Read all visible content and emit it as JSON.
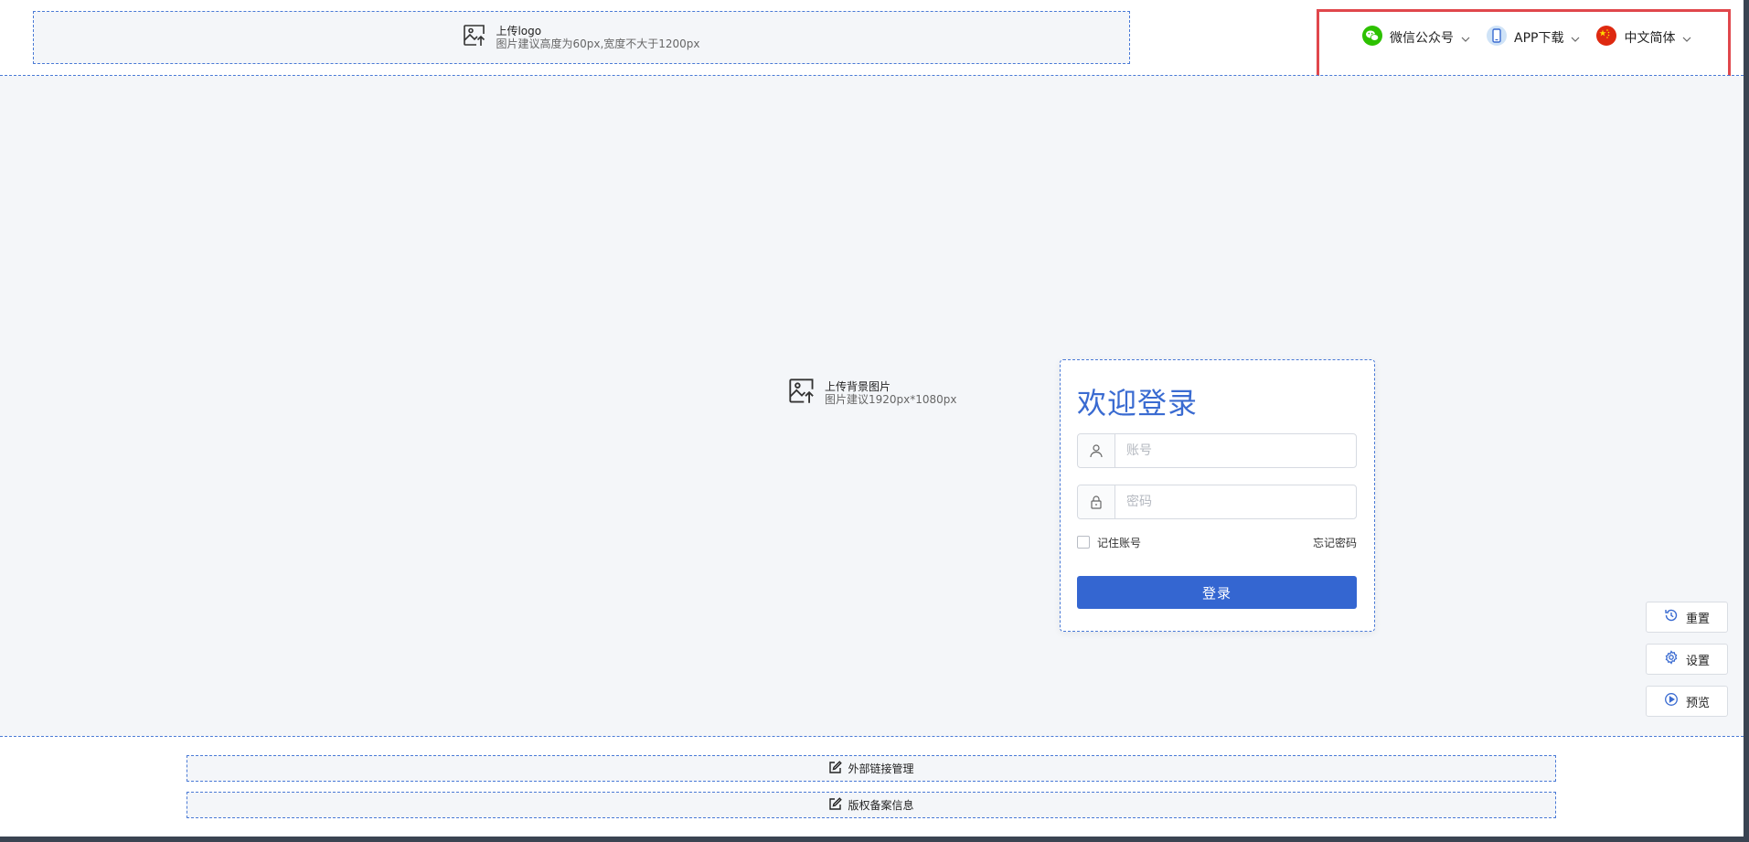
{
  "header": {
    "logo_upload": {
      "title": "上传logo",
      "hint": "图片建议高度为60px,宽度不大于1200px"
    },
    "wechat_label": "微信公众号",
    "app_label": "APP下载",
    "language_label": "中文简体"
  },
  "background_upload": {
    "title": "上传背景图片",
    "hint": "图片建议1920px*1080px"
  },
  "login": {
    "title": "欢迎登录",
    "account_placeholder": "账号",
    "password_placeholder": "密码",
    "remember_label": "记住账号",
    "forgot_label": "忘记密码",
    "submit_label": "登录"
  },
  "side_actions": {
    "reset_label": "重置",
    "settings_label": "设置",
    "preview_label": "预览"
  },
  "footer": {
    "external_links_label": "外部链接管理",
    "copyright_label": "版权备案信息"
  },
  "colors": {
    "accent": "#3466d1",
    "title": "#3a6bd1",
    "dashed_border": "#4a7ad6",
    "highlight_box": "#e0474c",
    "wechat_green": "#2dc100",
    "panel_bg": "#f4f6f9"
  },
  "icons": {
    "logo_upload": "image-upload-icon",
    "wechat": "wechat-icon",
    "app": "mobile-phone-icon",
    "language": "china-flag-icon",
    "chevron": "chevron-down-icon",
    "user": "user-icon",
    "lock": "lock-icon",
    "reset": "history-icon",
    "settings": "gear-icon",
    "preview": "play-circle-icon",
    "edit": "edit-icon"
  }
}
